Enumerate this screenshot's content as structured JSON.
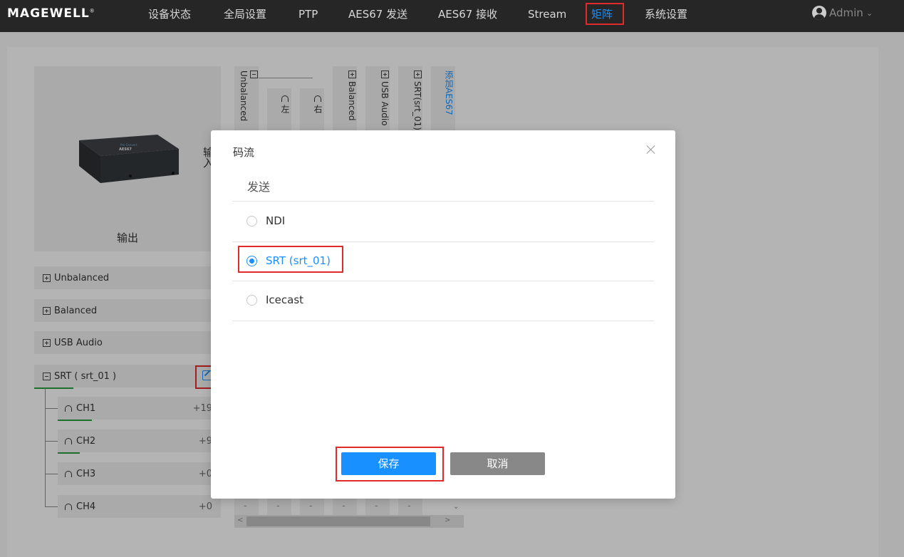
{
  "app": {
    "logo": "MAGEWELL",
    "logo_mark": "®"
  },
  "nav": {
    "items": [
      {
        "label": "设备状态"
      },
      {
        "label": "全局设置"
      },
      {
        "label": "PTP"
      },
      {
        "label": "AES67 发送"
      },
      {
        "label": "AES67 接收"
      },
      {
        "label": "Stream"
      },
      {
        "label": "矩阵",
        "active": true
      },
      {
        "label": "系统设置"
      }
    ],
    "user": "Admin"
  },
  "matrix": {
    "device_label": "输出",
    "input_label": "输入",
    "device_brand": "Pro Convert",
    "device_model": "AES67",
    "groups": [
      {
        "label": "Unbalanced",
        "expanded": false
      },
      {
        "label": "Balanced",
        "expanded": false
      },
      {
        "label": "USB Audio",
        "expanded": false
      },
      {
        "label": "SRT ( srt_01 )",
        "expanded": true
      }
    ],
    "channels": [
      {
        "label": "CH1",
        "value": "+19"
      },
      {
        "label": "CH2",
        "value": "+9"
      },
      {
        "label": "CH3",
        "value": "+0"
      },
      {
        "label": "CH4",
        "value": "+0"
      }
    ],
    "columns": [
      {
        "label": "Unbalanced"
      },
      {
        "label": "左"
      },
      {
        "label": "右"
      },
      {
        "label": "Balanced"
      },
      {
        "label": "USB Audio"
      },
      {
        "label": "SRT(srt_01)"
      },
      {
        "label": "添加AES67"
      }
    ],
    "cell_placeholder": "-"
  },
  "modal": {
    "title": "码流",
    "section": "发送",
    "options": [
      {
        "label": "NDI",
        "checked": false
      },
      {
        "label": "SRT (srt_01)",
        "checked": true
      },
      {
        "label": "Icecast",
        "checked": false
      }
    ],
    "save_label": "保存",
    "cancel_label": "取消"
  },
  "colors": {
    "accent": "#1890ff",
    "highlight": "#e12b2b",
    "level": "#2a9d3d",
    "topbar": "#262626"
  }
}
